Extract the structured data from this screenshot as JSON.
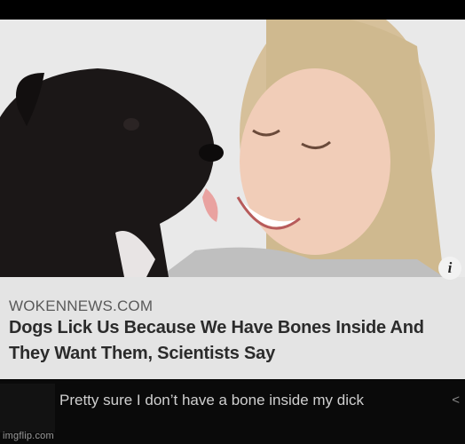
{
  "article": {
    "source": "WOKENNEWS.COM",
    "headline": "Dogs Lick Us Because We Have Bones Inside And They Want Them, Scientists Say",
    "info_glyph": "i"
  },
  "comment": {
    "text": "Pretty sure I don’t have a bone inside my dick",
    "reply_glyph": "<"
  },
  "watermark": "imgflip.com",
  "photo": {
    "icon": "dog-licking-woman-photo",
    "colors": {
      "background": "#e6e6e6",
      "dog": "#1a1616",
      "skin": "#f0c9b4",
      "hair": "#d8c39b"
    }
  }
}
